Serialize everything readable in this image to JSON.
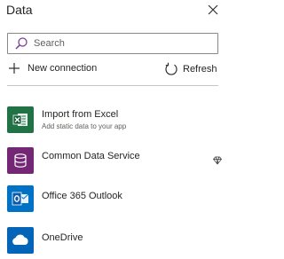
{
  "panel": {
    "title": "Data"
  },
  "search": {
    "placeholder": "Search",
    "value": ""
  },
  "actions": {
    "new_connection_label": "New connection",
    "refresh_label": "Refresh"
  },
  "connectors": [
    {
      "name": "Import from Excel",
      "subtitle": "Add static data to your app",
      "icon": "excel-icon",
      "color": "#217346"
    },
    {
      "name": "Common Data Service",
      "icon": "database-icon",
      "color": "#742774",
      "premium_icon": "diamond-icon"
    },
    {
      "name": "Office 365 Outlook",
      "icon": "outlook-icon",
      "color": "#0072c6"
    },
    {
      "name": "OneDrive",
      "icon": "cloud-icon",
      "color": "#0364b8"
    }
  ]
}
